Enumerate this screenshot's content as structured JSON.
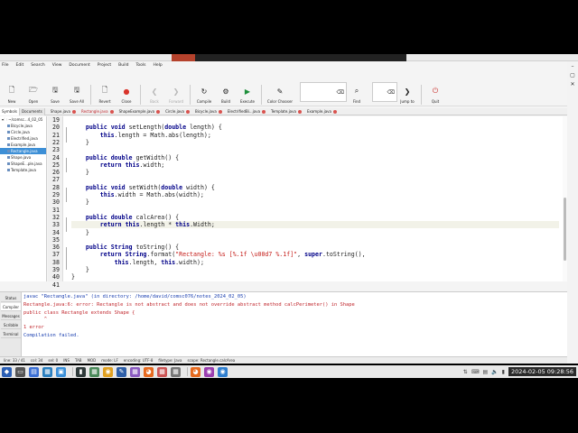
{
  "menubar": [
    "File",
    "Edit",
    "Search",
    "View",
    "Document",
    "Project",
    "Build",
    "Tools",
    "Help"
  ],
  "toolbar": {
    "new": "New",
    "open": "Open",
    "save": "Save",
    "save_all": "Save All",
    "revert": "Revert",
    "close": "Close",
    "back": "Back",
    "forward": "Forward",
    "compile": "Compile",
    "build": "Build",
    "execute": "Execute",
    "color_chooser": "Color Chooser",
    "find": "Find",
    "jump_to": "Jump to",
    "quit": "Quit"
  },
  "left_tabs": [
    "Symbols",
    "Documents"
  ],
  "file_tabs": [
    "Shape.java",
    "Rectangle.java",
    "ShapeExample.java",
    "Circle.java",
    "Bicycle.java",
    "ElectrifiedBi...java",
    "Template.java",
    "Example.java"
  ],
  "active_file_tab": "Rectangle.java",
  "sidebar": {
    "root": "~/comsc...4_02_05",
    "items": [
      "Bicycle.java",
      "Circle.java",
      "Electrified.java",
      "Example.java",
      "Rectangle.java",
      "Shape.java",
      "ShapeE...ple.java",
      "Template.java"
    ],
    "selected": "Rectangle.java"
  },
  "editor": {
    "line_numbers": [
      "19",
      "20",
      "21",
      "22",
      "23",
      "24",
      "25",
      "26",
      "27",
      "28",
      "29",
      "30",
      "31",
      "32",
      "33",
      "34",
      "35",
      "36",
      "37",
      "38",
      "39",
      "40",
      "41"
    ],
    "lines": [
      "",
      "    public void setLength(double length) {",
      "        this.length = Math.abs(length);",
      "    }",
      "",
      "    public double getWidth() {",
      "        return this.width;",
      "    }",
      "",
      "    public void setWidth(double width) {",
      "        this.width = Math.abs(width);",
      "    }",
      "",
      "    public double calcArea() {",
      "        return this.length * this.Width;",
      "    }",
      "",
      "    public String toString() {",
      "        return String.format(\"Rectangle: %s [%.1f \\u00d7 %.1f]\", super.toString(),",
      "            this.length, this.width);",
      "    }",
      "}",
      ""
    ],
    "current_line": "33"
  },
  "bottom_tabs": [
    "Status",
    "Compiler",
    "Messages",
    "Scribble",
    "Terminal"
  ],
  "active_bottom_tab": "Compiler",
  "compiler": [
    {
      "text": "javac \"Rectangle.java\" (in directory: /home/david/comsc076/notes_2024_02_05)",
      "color": "blue"
    },
    {
      "text": "Rectangle.java:6: error: Rectangle is not abstract and does not override abstract method calcPerimeter() in Shape",
      "color": "red"
    },
    {
      "text": "public class Rectangle extends Shape {",
      "color": "red"
    },
    {
      "text": "       ^",
      "color": "red"
    },
    {
      "text": "1 error",
      "color": "red"
    },
    {
      "text": "Compilation failed.",
      "color": "blue"
    }
  ],
  "statusbar": {
    "line": "line: 33 / 41",
    "col": "col: 34",
    "sel": "sel: 0",
    "ins": "INS",
    "tab": "TAB",
    "mod": "MOD",
    "mode": "mode: LF",
    "encoding": "encoding: UTF-8",
    "filetype": "filetype: Java",
    "scope": "scope: Rectangle.calcArea"
  },
  "clock": "2024-02-05 09:28:56",
  "colors": {
    "accent": "#3d8fd6",
    "error": "#c0262c",
    "info": "#1a3fb0"
  }
}
